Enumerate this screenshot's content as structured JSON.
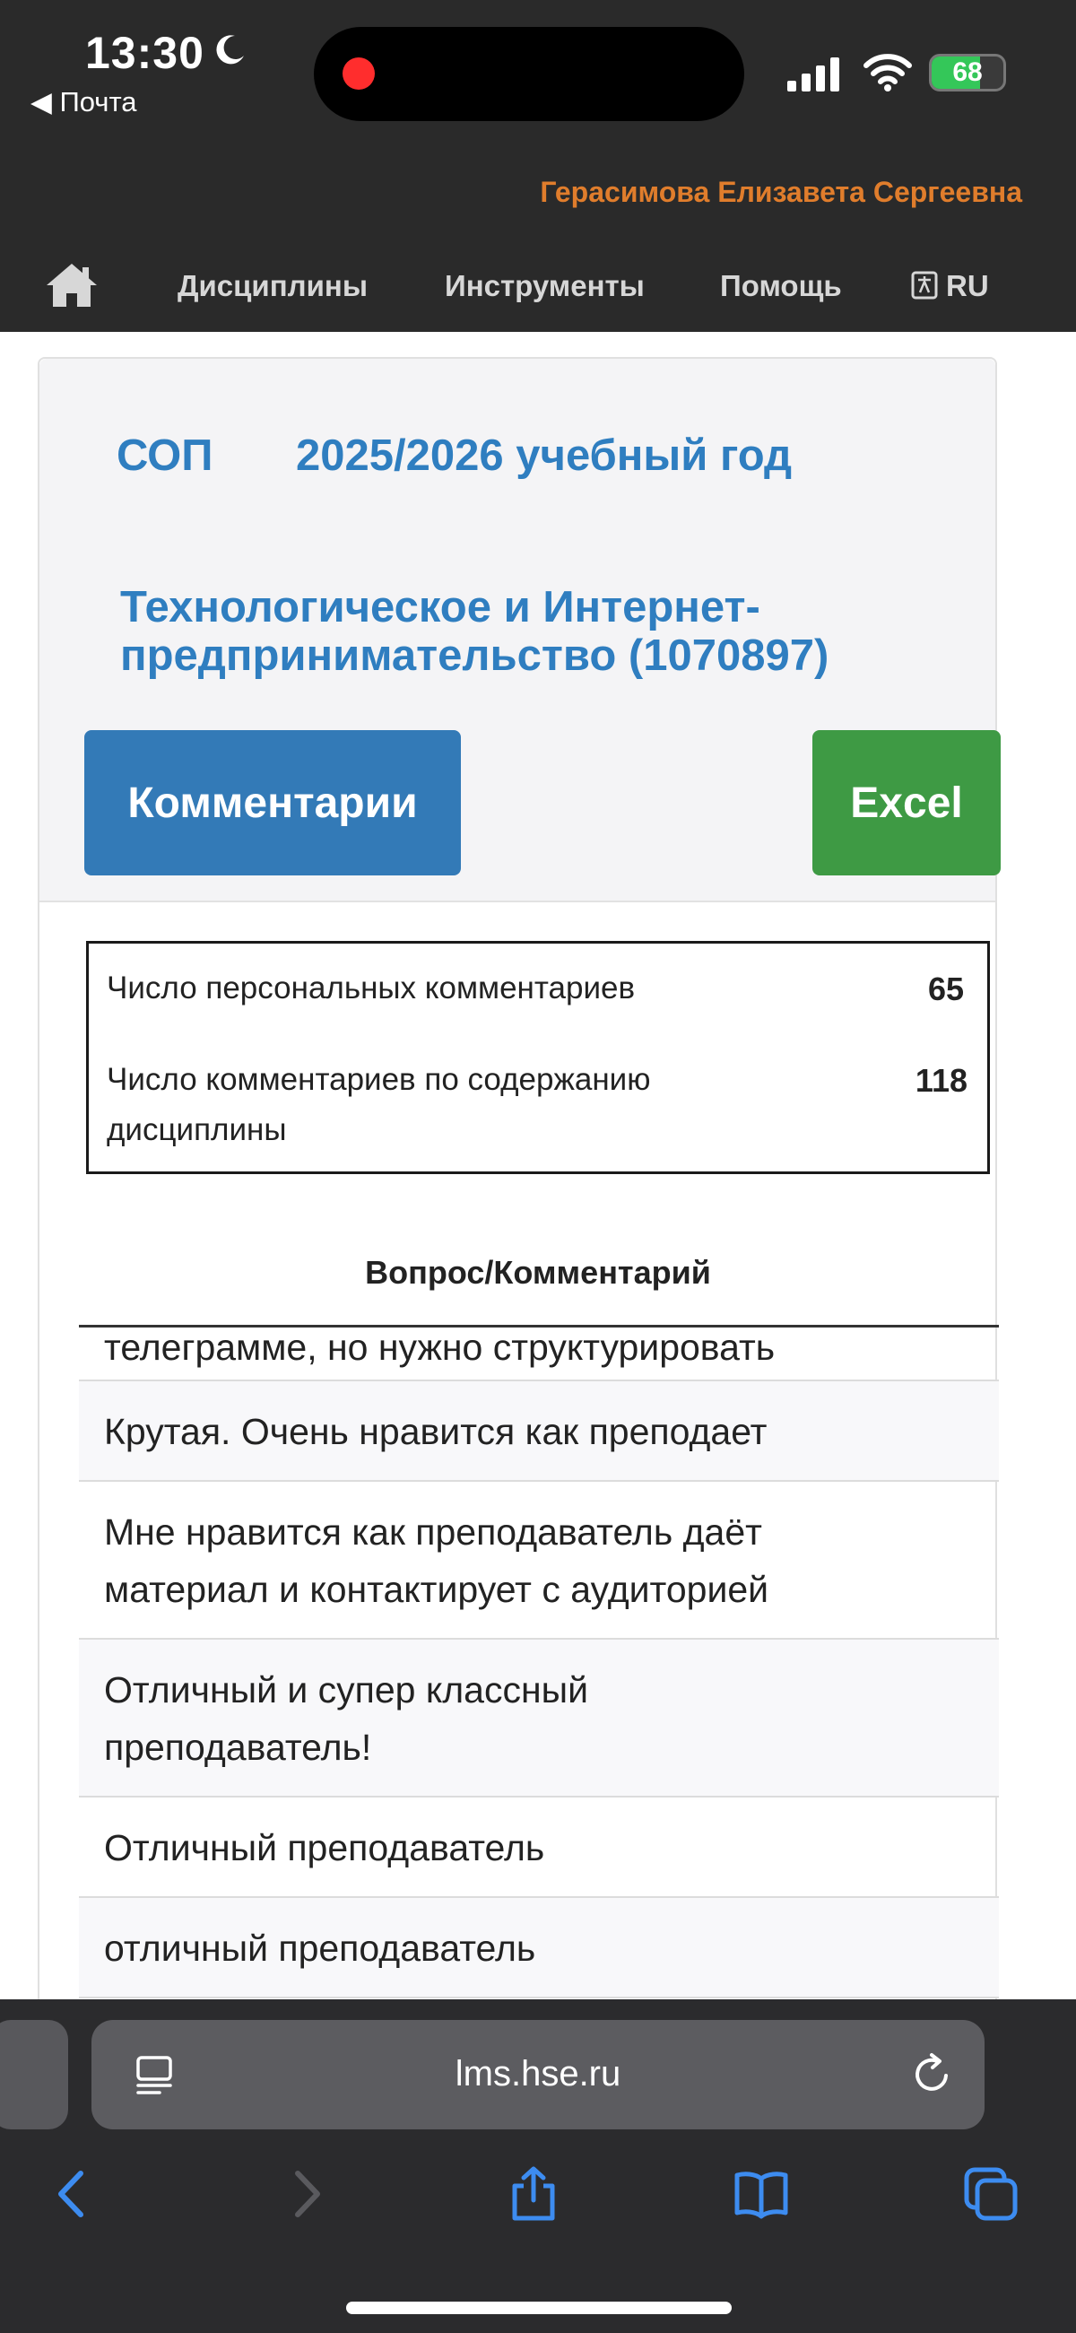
{
  "status_bar": {
    "time": "13:30",
    "back_app": "◀ Почта",
    "battery": "68",
    "battery_level": 0.68
  },
  "header": {
    "username": "Герасимова Елизавета Сергеевна"
  },
  "nav": {
    "items": [
      "Дисциплины",
      "Инструменты",
      "Помощь"
    ],
    "lang": "RU"
  },
  "course": {
    "program": "СОП",
    "year": "2025/2026 учебный год",
    "title_line1": "Технологическое и Интернет-",
    "title_line2": "предпринимательство (1070897)",
    "comments_button": "Комментарии",
    "excel_button": "Excel"
  },
  "stats": {
    "personal_label": "Число персональных комментариев",
    "personal_value": "65",
    "content_label_line1": "Число комментариев по содержанию",
    "content_label_line2": "дисциплины",
    "content_value": "118"
  },
  "table": {
    "header": "Вопрос/Комментарий",
    "rows": [
      "телеграмме, но нужно структурировать",
      "Крутая. Очень нравится как преподает",
      "Мне нравится как преподаватель даёт материал и контактирует с аудиторией",
      "Отличный и супер классный преподаватель!",
      "Отличный преподаватель",
      "отличный преподаватель"
    ]
  },
  "browser": {
    "url": "lms.hse.ru"
  },
  "colors": {
    "accent_blue": "#337ab7",
    "excel_green": "#3e9a44",
    "username_orange": "#e07d2c"
  }
}
